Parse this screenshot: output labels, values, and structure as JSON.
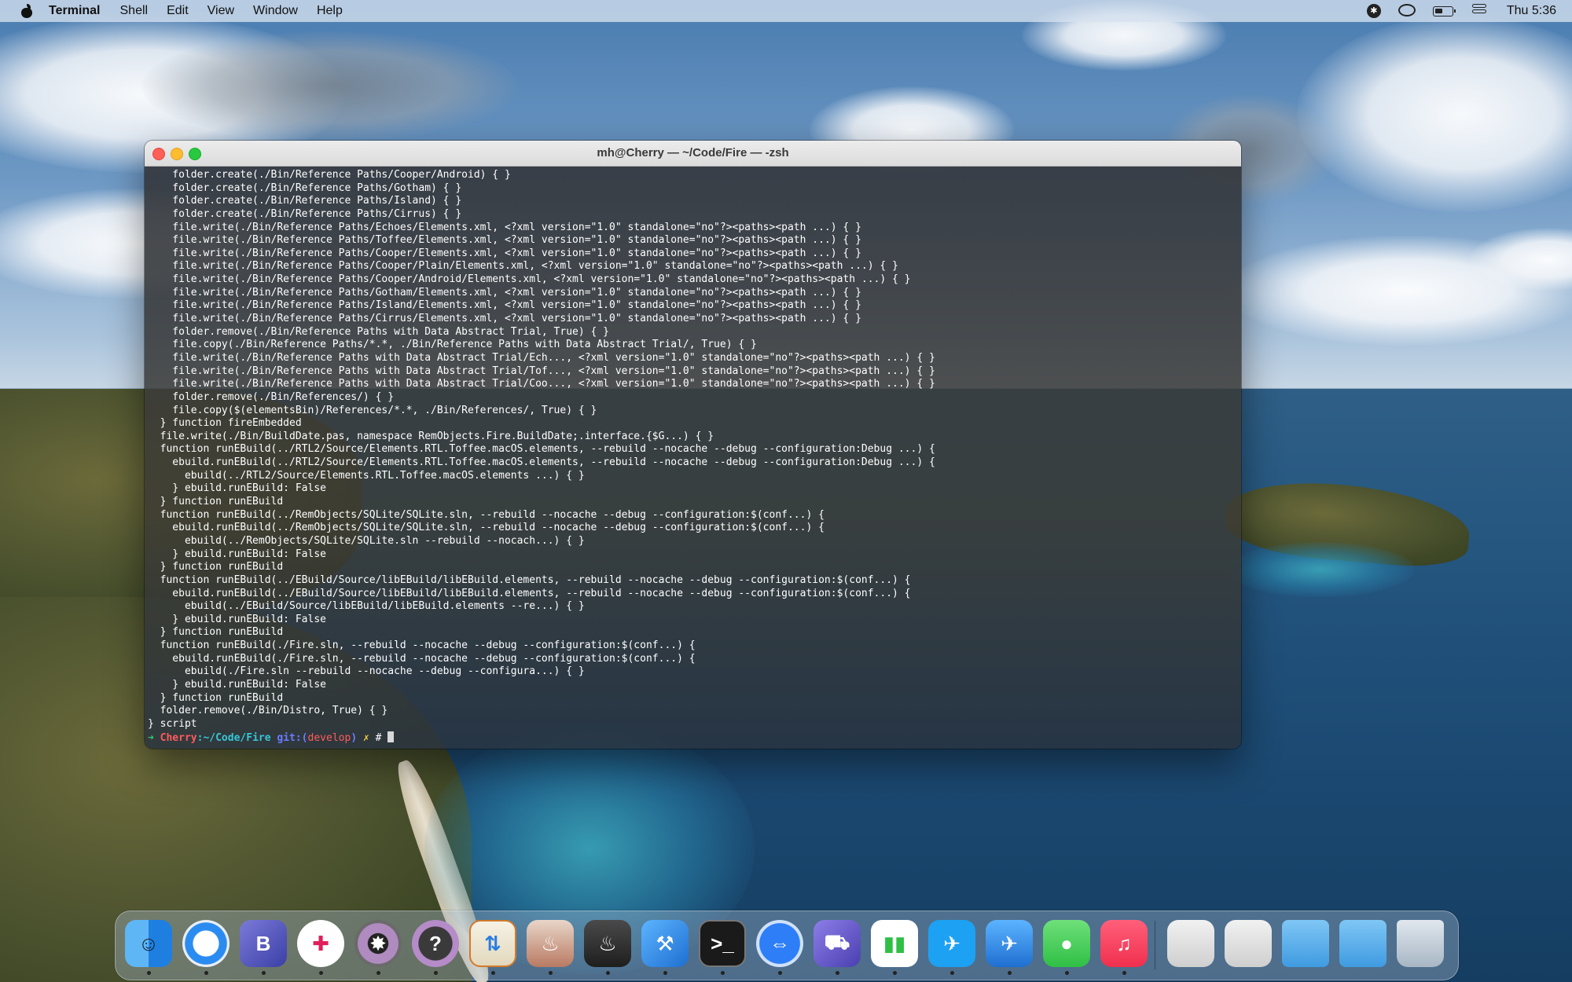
{
  "menubar": {
    "app_name": "Terminal",
    "items": [
      "Shell",
      "Edit",
      "View",
      "Window",
      "Help"
    ],
    "clock": "Thu 5:36",
    "status_icons": [
      "bluetooth-icon",
      "creative-cloud-icon",
      "battery-icon",
      "control-center-icon"
    ]
  },
  "terminal": {
    "title": "mh@Cherry — ~/Code/Fire — -zsh",
    "lines": [
      "    folder.create(./Bin/Reference Paths/Cooper/Android) { }",
      "    folder.create(./Bin/Reference Paths/Gotham) { }",
      "    folder.create(./Bin/Reference Paths/Island) { }",
      "    folder.create(./Bin/Reference Paths/Cirrus) { }",
      "    file.write(./Bin/Reference Paths/Echoes/Elements.xml, <?xml version=\"1.0\" standalone=\"no\"?><paths><path ...) { }",
      "    file.write(./Bin/Reference Paths/Toffee/Elements.xml, <?xml version=\"1.0\" standalone=\"no\"?><paths><path ...) { }",
      "    file.write(./Bin/Reference Paths/Cooper/Elements.xml, <?xml version=\"1.0\" standalone=\"no\"?><paths><path ...) { }",
      "    file.write(./Bin/Reference Paths/Cooper/Plain/Elements.xml, <?xml version=\"1.0\" standalone=\"no\"?><paths><path ...) { }",
      "    file.write(./Bin/Reference Paths/Cooper/Android/Elements.xml, <?xml version=\"1.0\" standalone=\"no\"?><paths><path ...) { }",
      "    file.write(./Bin/Reference Paths/Gotham/Elements.xml, <?xml version=\"1.0\" standalone=\"no\"?><paths><path ...) { }",
      "    file.write(./Bin/Reference Paths/Island/Elements.xml, <?xml version=\"1.0\" standalone=\"no\"?><paths><path ...) { }",
      "    file.write(./Bin/Reference Paths/Cirrus/Elements.xml, <?xml version=\"1.0\" standalone=\"no\"?><paths><path ...) { }",
      "    folder.remove(./Bin/Reference Paths with Data Abstract Trial, True) { }",
      "    file.copy(./Bin/Reference Paths/*.*, ./Bin/Reference Paths with Data Abstract Trial/, True) { }",
      "    file.write(./Bin/Reference Paths with Data Abstract Trial/Ech..., <?xml version=\"1.0\" standalone=\"no\"?><paths><path ...) { }",
      "    file.write(./Bin/Reference Paths with Data Abstract Trial/Tof..., <?xml version=\"1.0\" standalone=\"no\"?><paths><path ...) { }",
      "    file.write(./Bin/Reference Paths with Data Abstract Trial/Coo..., <?xml version=\"1.0\" standalone=\"no\"?><paths><path ...) { }",
      "    folder.remove(./Bin/References/) { }",
      "    file.copy($(elementsBin)/References/*.*, ./Bin/References/, True) { }",
      "  } function fireEmbedded",
      "  file.write(./Bin/BuildDate.pas, namespace RemObjects.Fire.BuildDate;.interface.{$G...) { }",
      "  function runEBuild(../RTL2/Source/Elements.RTL.Toffee.macOS.elements, --rebuild --nocache --debug --configuration:Debug ...) {",
      "    ebuild.runEBuild(../RTL2/Source/Elements.RTL.Toffee.macOS.elements, --rebuild --nocache --debug --configuration:Debug ...) {",
      "      ebuild(../RTL2/Source/Elements.RTL.Toffee.macOS.elements ...) { }",
      "    } ebuild.runEBuild: False",
      "  } function runEBuild",
      "  function runEBuild(../RemObjects/SQLite/SQLite.sln, --rebuild --nocache --debug --configuration:$(conf...) {",
      "    ebuild.runEBuild(../RemObjects/SQLite/SQLite.sln, --rebuild --nocache --debug --configuration:$(conf...) {",
      "      ebuild(../RemObjects/SQLite/SQLite.sln --rebuild --nocach...) { }",
      "    } ebuild.runEBuild: False",
      "  } function runEBuild",
      "  function runEBuild(../EBuild/Source/libEBuild/libEBuild.elements, --rebuild --nocache --debug --configuration:$(conf...) {",
      "    ebuild.runEBuild(../EBuild/Source/libEBuild/libEBuild.elements, --rebuild --nocache --debug --configuration:$(conf...) {",
      "      ebuild(../EBuild/Source/libEBuild/libEBuild.elements --re...) { }",
      "    } ebuild.runEBuild: False",
      "  } function runEBuild",
      "  function runEBuild(./Fire.sln, --rebuild --nocache --debug --configuration:$(conf...) {",
      "    ebuild.runEBuild(./Fire.sln, --rebuild --nocache --debug --configuration:$(conf...) {",
      "      ebuild(./Fire.sln --rebuild --nocache --debug --configura...) { }",
      "    } ebuild.runEBuild: False",
      "  } function runEBuild",
      "  folder.remove(./Bin/Distro, True) { }",
      "} script"
    ],
    "prompt": {
      "arrow": "➜",
      "host": "Cherry",
      "sep": ":",
      "path": "~/Code/Fire",
      "git": "git:(",
      "branch": "develop",
      "git_close": ")",
      "dirty": "✗",
      "symbol": "#"
    }
  },
  "dock": {
    "apps": [
      {
        "name": "finder-icon",
        "running": true
      },
      {
        "name": "safari-icon",
        "running": true
      },
      {
        "name": "bbedit-icon",
        "running": true
      },
      {
        "name": "slack-icon",
        "running": true
      },
      {
        "name": "bug-tracker-icon",
        "running": true
      },
      {
        "name": "help-icon",
        "running": true
      },
      {
        "name": "transmit-icon",
        "running": true
      },
      {
        "name": "fire-ide-icon",
        "running": true
      },
      {
        "name": "fire-icon",
        "running": true
      },
      {
        "name": "xcode-icon",
        "running": true
      },
      {
        "name": "terminal-icon",
        "running": true
      },
      {
        "name": "teamviewer-icon",
        "running": true
      },
      {
        "name": "builder-icon",
        "running": true
      },
      {
        "name": "numbers-icon",
        "running": true
      },
      {
        "name": "twitter-icon",
        "running": true
      },
      {
        "name": "testflight-icon",
        "running": true
      },
      {
        "name": "messages-icon",
        "running": true
      },
      {
        "name": "music-icon",
        "running": true
      }
    ],
    "stacks": [
      "archive-stack-1-icon",
      "archive-stack-2-icon",
      "folder-stack-icon",
      "downloads-stack-icon",
      "trash-icon"
    ],
    "colors": {
      "terminal_bg": "#2b2f34",
      "prompt_arrow": "#2ecc71",
      "prompt_host": "#ff5b5b",
      "prompt_path": "#36c6d8",
      "prompt_git": "#6b7cff",
      "prompt_dirty": "#f4d03f"
    }
  }
}
